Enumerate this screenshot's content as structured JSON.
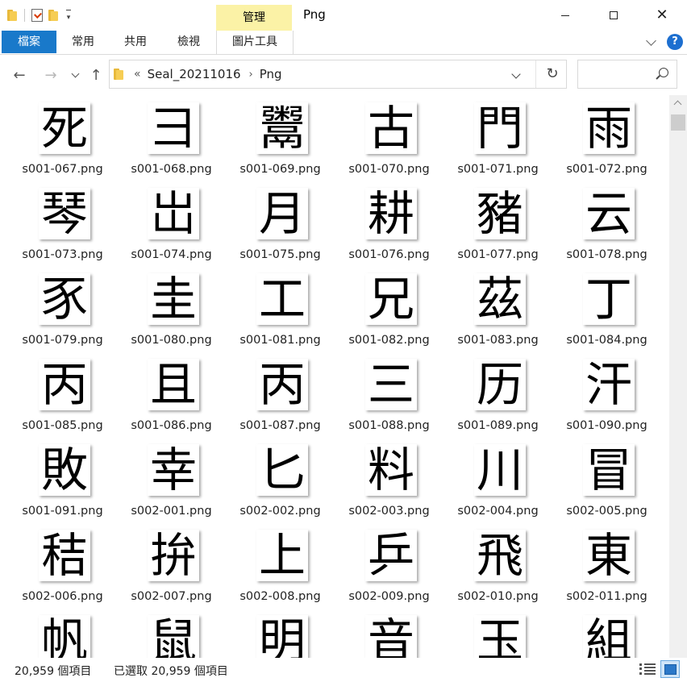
{
  "titlebar": {
    "manage_tab": "管理",
    "window_title": "Png"
  },
  "ribbon": {
    "tabs": [
      {
        "id": "file",
        "label": "檔案"
      },
      {
        "id": "home",
        "label": "常用"
      },
      {
        "id": "share",
        "label": "共用"
      },
      {
        "id": "view",
        "label": "檢視"
      },
      {
        "id": "pictools",
        "label": "圖片工具"
      }
    ]
  },
  "address": {
    "overflow": "«",
    "crumbs": [
      "Seal_20211016",
      "Png"
    ],
    "search_placeholder": ""
  },
  "files": [
    {
      "name": "s001-067.png",
      "glyph": "死"
    },
    {
      "name": "s001-068.png",
      "glyph": "彐"
    },
    {
      "name": "s001-069.png",
      "glyph": "鬻"
    },
    {
      "name": "s001-070.png",
      "glyph": "古"
    },
    {
      "name": "s001-071.png",
      "glyph": "門"
    },
    {
      "name": "s001-072.png",
      "glyph": "雨"
    },
    {
      "name": "s001-073.png",
      "glyph": "琴"
    },
    {
      "name": "s001-074.png",
      "glyph": "岀"
    },
    {
      "name": "s001-075.png",
      "glyph": "月"
    },
    {
      "name": "s001-076.png",
      "glyph": "耕"
    },
    {
      "name": "s001-077.png",
      "glyph": "豬"
    },
    {
      "name": "s001-078.png",
      "glyph": "云"
    },
    {
      "name": "s001-079.png",
      "glyph": "豕"
    },
    {
      "name": "s001-080.png",
      "glyph": "圭"
    },
    {
      "name": "s001-081.png",
      "glyph": "工"
    },
    {
      "name": "s001-082.png",
      "glyph": "兄"
    },
    {
      "name": "s001-083.png",
      "glyph": "茲"
    },
    {
      "name": "s001-084.png",
      "glyph": "丁"
    },
    {
      "name": "s001-085.png",
      "glyph": "丙"
    },
    {
      "name": "s001-086.png",
      "glyph": "且"
    },
    {
      "name": "s001-087.png",
      "glyph": "丙"
    },
    {
      "name": "s001-088.png",
      "glyph": "三"
    },
    {
      "name": "s001-089.png",
      "glyph": "历"
    },
    {
      "name": "s001-090.png",
      "glyph": "汗"
    },
    {
      "name": "s001-091.png",
      "glyph": "敗"
    },
    {
      "name": "s002-001.png",
      "glyph": "幸"
    },
    {
      "name": "s002-002.png",
      "glyph": "匕"
    },
    {
      "name": "s002-003.png",
      "glyph": "料"
    },
    {
      "name": "s002-004.png",
      "glyph": "川"
    },
    {
      "name": "s002-005.png",
      "glyph": "冒"
    },
    {
      "name": "s002-006.png",
      "glyph": "秸"
    },
    {
      "name": "s002-007.png",
      "glyph": "拚"
    },
    {
      "name": "s002-008.png",
      "glyph": "上"
    },
    {
      "name": "s002-009.png",
      "glyph": "乒"
    },
    {
      "name": "s002-010.png",
      "glyph": "飛"
    },
    {
      "name": "s002-011.png",
      "glyph": "東"
    },
    {
      "name": "",
      "glyph": "帆"
    },
    {
      "name": "",
      "glyph": "鼠"
    },
    {
      "name": "",
      "glyph": "明"
    },
    {
      "name": "",
      "glyph": "音"
    },
    {
      "name": "",
      "glyph": "玉"
    },
    {
      "name": "",
      "glyph": "組"
    }
  ],
  "status": {
    "item_count": "20,959 個項目",
    "selected": "已選取 20,959 個項目"
  }
}
